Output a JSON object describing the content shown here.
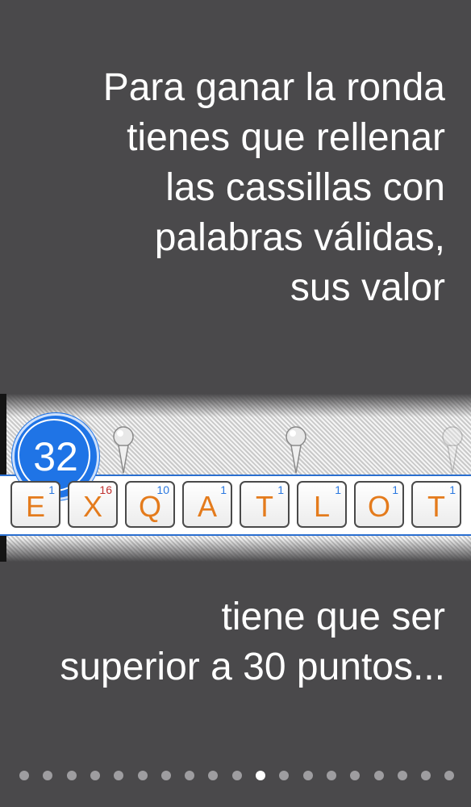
{
  "intro_lines": [
    "Para ganar la ronda",
    "tienes que rellenar",
    "las cassillas con",
    "palabras válidas,",
    "sus valor"
  ],
  "board": {
    "score": "32",
    "tiles": [
      {
        "letter": "E",
        "points": "1"
      },
      {
        "letter": "X",
        "points": "16"
      },
      {
        "letter": "Q",
        "points": "10"
      },
      {
        "letter": "A",
        "points": "1"
      },
      {
        "letter": "T",
        "points": "1"
      },
      {
        "letter": "L",
        "points": "1"
      },
      {
        "letter": "O",
        "points": "1"
      },
      {
        "letter": "T",
        "points": "1"
      }
    ],
    "colors": {
      "score_circle": "#1f74e6",
      "letter": "#e47b1c",
      "points": "#2a78e0",
      "high_points": "#c0302e",
      "row_border": "#2a6fd0"
    }
  },
  "outro_lines": [
    "tiene que ser",
    "superior a 30 puntos..."
  ],
  "pagination": {
    "total": 19,
    "current": 11
  }
}
